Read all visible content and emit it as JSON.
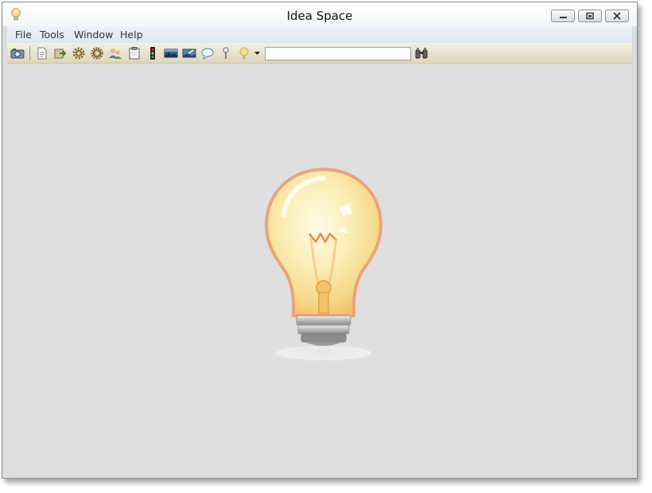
{
  "window": {
    "title": "Idea Space",
    "icon": "lightbulb-icon"
  },
  "window_controls": [
    "minimize-icon",
    "restore-icon",
    "close-icon"
  ],
  "menubar": {
    "items": [
      {
        "label": "File"
      },
      {
        "label": "Tools"
      },
      {
        "label": "Window"
      },
      {
        "label": "Help"
      }
    ]
  },
  "toolbar": {
    "icons": [
      "camera-icon",
      "document-icon",
      "export-icon",
      "gear-icon",
      "sun-gear-icon",
      "users-icon",
      "clipboard-icon",
      "traffic-light-icon",
      "landscape-icon",
      "image-edit-icon",
      "speech-bubble-icon",
      "pin-icon",
      "lightbulb-icon",
      "dropdown-arrow-icon",
      "binoculars-icon"
    ],
    "search": {
      "value": "",
      "placeholder": ""
    }
  },
  "colors": {
    "window_bg": "#dfdfdf",
    "toolbar_bg": "#e9e4cf",
    "menubar_bg": "#e5ebf5",
    "bulb_glow": "#f7d9a0",
    "bulb_outline": "#e9a277"
  }
}
